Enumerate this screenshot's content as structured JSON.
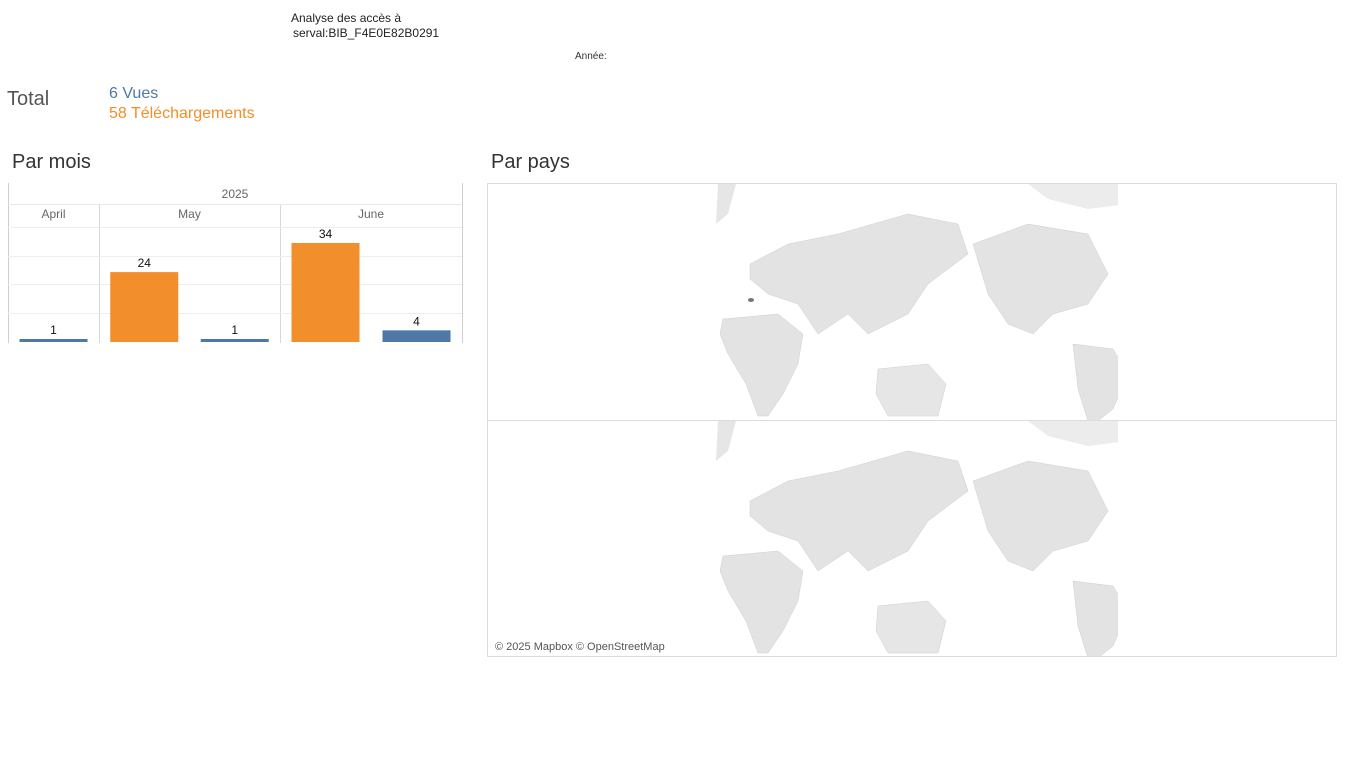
{
  "header": {
    "title_line1": "Analyse des accès à",
    "title_line2": "serval:BIB_F4E0E82B0291",
    "year_filter_label": "Année:"
  },
  "totals": {
    "label": "Total",
    "views": "6 Vues",
    "downloads": "58 Téléchargements"
  },
  "sections": {
    "by_month": "Par mois",
    "by_country": "Par pays"
  },
  "colors": {
    "views": "#4e79a7",
    "downloads": "#f28e2b"
  },
  "chart_data": {
    "type": "bar",
    "year": "2025",
    "categories": [
      "April",
      "May",
      "June"
    ],
    "series": [
      {
        "name": "Téléchargements",
        "values": [
          null,
          24,
          34
        ]
      },
      {
        "name": "Vues",
        "values": [
          1,
          1,
          4
        ]
      }
    ],
    "ylim": [
      0,
      34
    ],
    "grid": true
  },
  "map": {
    "highlighted_country": "Switzerland",
    "attribution": "© 2025 Mapbox © OpenStreetMap"
  }
}
